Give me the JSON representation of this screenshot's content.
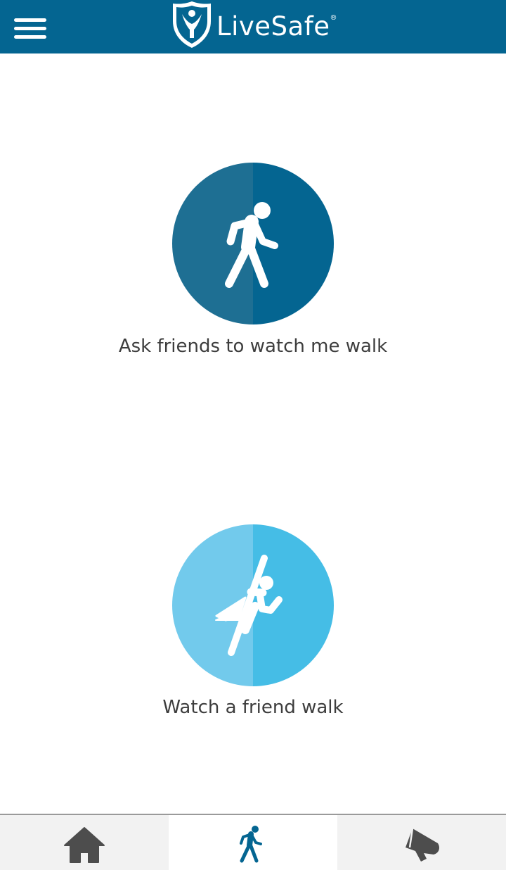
{
  "header": {
    "app_name": "LiveSafe",
    "registered_mark": "®",
    "menu_icon": "hamburger-menu-icon",
    "logo_icon": "livesafe-shield-logo",
    "background_color": "#046591"
  },
  "options": [
    {
      "label": "Ask friends to watch me walk",
      "icon": "walking-person-icon",
      "color_left": "#1e6f93",
      "color_right": "#046591"
    },
    {
      "label": "Watch a friend walk",
      "icon": "flying-hero-icon",
      "color_left": "#72caec",
      "color_right": "#45bde6"
    }
  ],
  "bottom_nav": {
    "items": [
      {
        "icon": "home-icon",
        "active": false
      },
      {
        "icon": "walking-person-icon",
        "active": true
      },
      {
        "icon": "megaphone-icon",
        "active": false
      }
    ],
    "active_color": "#046591",
    "inactive_color": "#4d4d4d"
  }
}
